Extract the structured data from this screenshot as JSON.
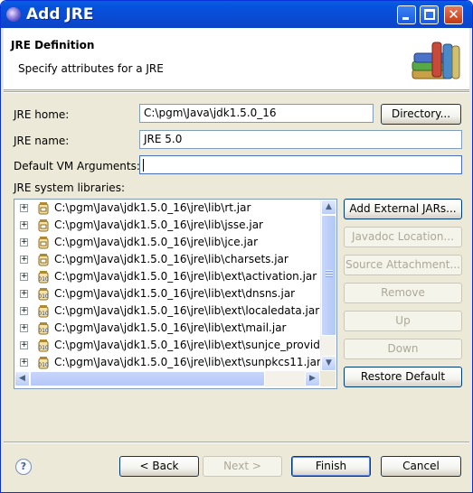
{
  "window": {
    "title": "Add JRE",
    "minimize_icon": "minimize-icon",
    "maximize_icon": "maximize-icon",
    "close_icon": "close-icon"
  },
  "banner": {
    "title": "JRE Definition",
    "description": "Specify attributes for a JRE",
    "icon": "library-books-icon"
  },
  "form": {
    "jre_home_label": "JRE home:",
    "jre_home_value": "C:\\pgm\\Java\\jdk1.5.0_16",
    "directory_button": "Directory...",
    "jre_name_label": "JRE name:",
    "jre_name_value": "JRE 5.0",
    "vm_args_label": "Default VM Arguments:",
    "vm_args_value": "",
    "libraries_label": "JRE system libraries:"
  },
  "libraries": [
    {
      "path": "C:\\pgm\\Java\\jdk1.5.0_16\\jre\\lib\\rt.jar",
      "icon": "jar-icon"
    },
    {
      "path": "C:\\pgm\\Java\\jdk1.5.0_16\\jre\\lib\\jsse.jar",
      "icon": "jar-icon"
    },
    {
      "path": "C:\\pgm\\Java\\jdk1.5.0_16\\jre\\lib\\jce.jar",
      "icon": "jar-icon"
    },
    {
      "path": "C:\\pgm\\Java\\jdk1.5.0_16\\jre\\lib\\charsets.jar",
      "icon": "jar-icon"
    },
    {
      "path": "C:\\pgm\\Java\\jdk1.5.0_16\\jre\\lib\\ext\\activation.jar",
      "icon": "binary-jar-icon"
    },
    {
      "path": "C:\\pgm\\Java\\jdk1.5.0_16\\jre\\lib\\ext\\dnsns.jar",
      "icon": "binary-jar-icon"
    },
    {
      "path": "C:\\pgm\\Java\\jdk1.5.0_16\\jre\\lib\\ext\\localedata.jar",
      "icon": "binary-jar-icon"
    },
    {
      "path": "C:\\pgm\\Java\\jdk1.5.0_16\\jre\\lib\\ext\\mail.jar",
      "icon": "binary-jar-icon"
    },
    {
      "path": "C:\\pgm\\Java\\jdk1.5.0_16\\jre\\lib\\ext\\sunjce_provide",
      "icon": "binary-jar-icon"
    },
    {
      "path": "C:\\pgm\\Java\\jdk1.5.0_16\\jre\\lib\\ext\\sunpkcs11.jar",
      "icon": "binary-jar-icon"
    }
  ],
  "library_buttons": {
    "add_external": "Add External JARs...",
    "javadoc": "Javadoc Location...",
    "source": "Source Attachment...",
    "remove": "Remove",
    "up": "Up",
    "down": "Down",
    "restore": "Restore Default"
  },
  "footer": {
    "help_icon": "help-icon",
    "back": "< Back",
    "next": "Next >",
    "finish": "Finish",
    "cancel": "Cancel"
  },
  "colors": {
    "title_bar": "#0a4bd4",
    "dialog_bg": "#ece9d8",
    "field_border": "#7f9db9",
    "disabled_text": "#aca899"
  }
}
